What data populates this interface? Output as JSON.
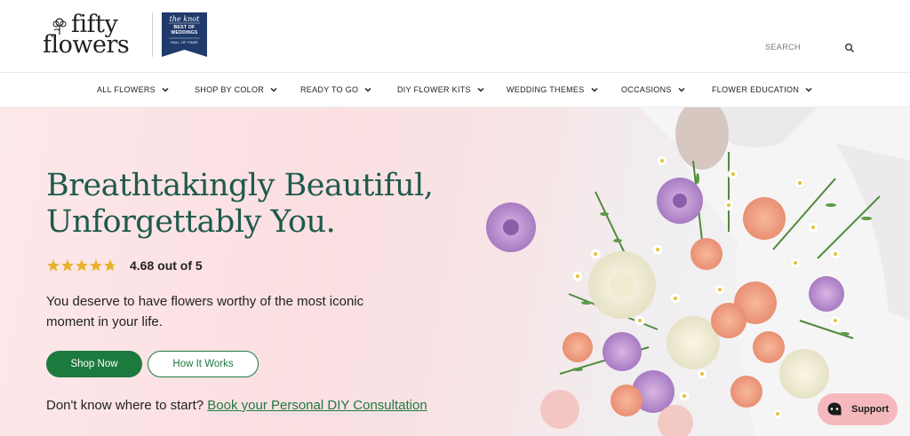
{
  "header": {
    "logo_line1": "fifty",
    "logo_line2": "flowers",
    "badge": {
      "line1": "the knot",
      "line2": "BEST OF WEDDINGS",
      "line3": "HALL OF FAME"
    },
    "search_placeholder": "SEARCH"
  },
  "nav": {
    "items": [
      {
        "label": "ALL FLOWERS"
      },
      {
        "label": "SHOP BY COLOR"
      },
      {
        "label": "READY TO GO"
      },
      {
        "label": "DIY FLOWER KITS"
      },
      {
        "label": "WEDDING THEMES"
      },
      {
        "label": "OCCASIONS"
      },
      {
        "label": "FLOWER EDUCATION"
      }
    ]
  },
  "hero": {
    "headline": "Breathtakingly Beautiful, Unforgettably You.",
    "rating": 4.68,
    "rating_max": 5,
    "rating_text": "4.68 out of 5",
    "description": "You deserve to have flowers worthy of the most iconic moment in your life.",
    "shop_button": "Shop Now",
    "how_button": "How It Works",
    "consult_prefix": "Don't know where to start?",
    "consult_link": "Book your Personal DIY Consultation"
  },
  "support": {
    "label": "Support"
  },
  "colors": {
    "brand_green": "#1d7a3e",
    "headline_green": "#1e5a4c",
    "badge_navy": "#1f3a6b",
    "star_gold": "#e8b32a",
    "support_pink": "#f5b9bd"
  },
  "icons": {
    "search": "search-icon",
    "chevron": "chevron-down-icon",
    "star": "star-icon",
    "support": "chat-bubble-icon"
  }
}
